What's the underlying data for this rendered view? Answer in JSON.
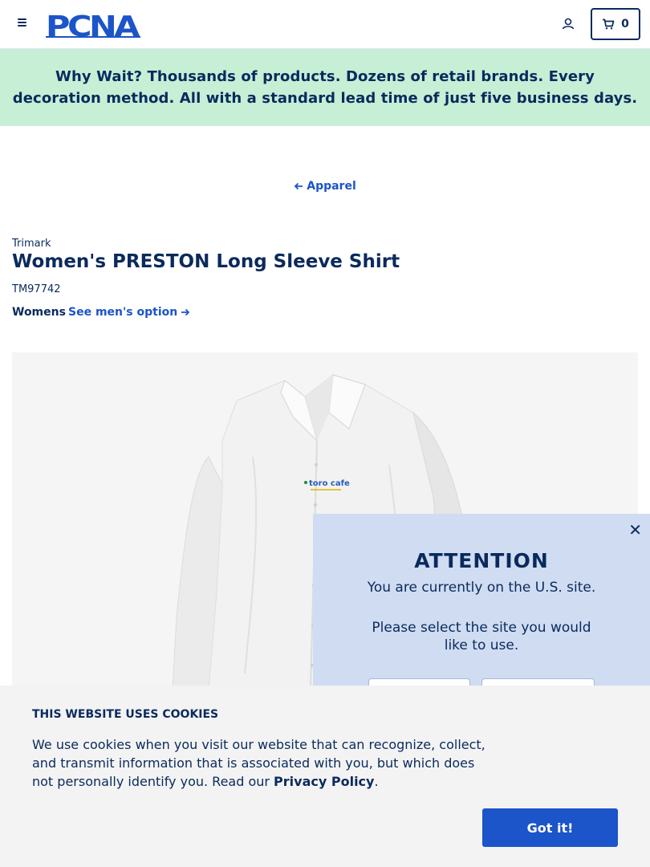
{
  "header": {
    "logo_text": "PCNA",
    "cart_count": "0"
  },
  "promo": {
    "lead": "Why Wait?",
    "message": " Thousands of products. Dozens of retail brands. Every decoration method. All with a standard lead time of just five business days."
  },
  "breadcrumb": {
    "back_label": "Apparel"
  },
  "product": {
    "brand": "Trimark",
    "title": "Women's PRESTON Long Sleeve Shirt",
    "sku": "TM97742",
    "gender": "Womens",
    "alt_option": "See men's option",
    "logo_imprint": "toro cafe"
  },
  "modal": {
    "title": "ATTENTION",
    "line1": "You are currently on the U.S. site.",
    "line2": "Please select the site you would like to use."
  },
  "cookie": {
    "title": "THIS WEBSITE USES COOKIES",
    "text": "We use cookies when you visit our website that can recognize, collect, and transmit information that is associated with you, but which does not personally identify you. Read our ",
    "link": "Privacy Policy",
    "suffix": ".",
    "accept": "Got it!"
  },
  "colors": {
    "navy": "#0a2a5c",
    "accent_blue": "#1c54c9",
    "promo_bg": "#c6efd6",
    "modal_bg": "#cfdcf2",
    "cookie_bg": "#f3f3f3"
  }
}
